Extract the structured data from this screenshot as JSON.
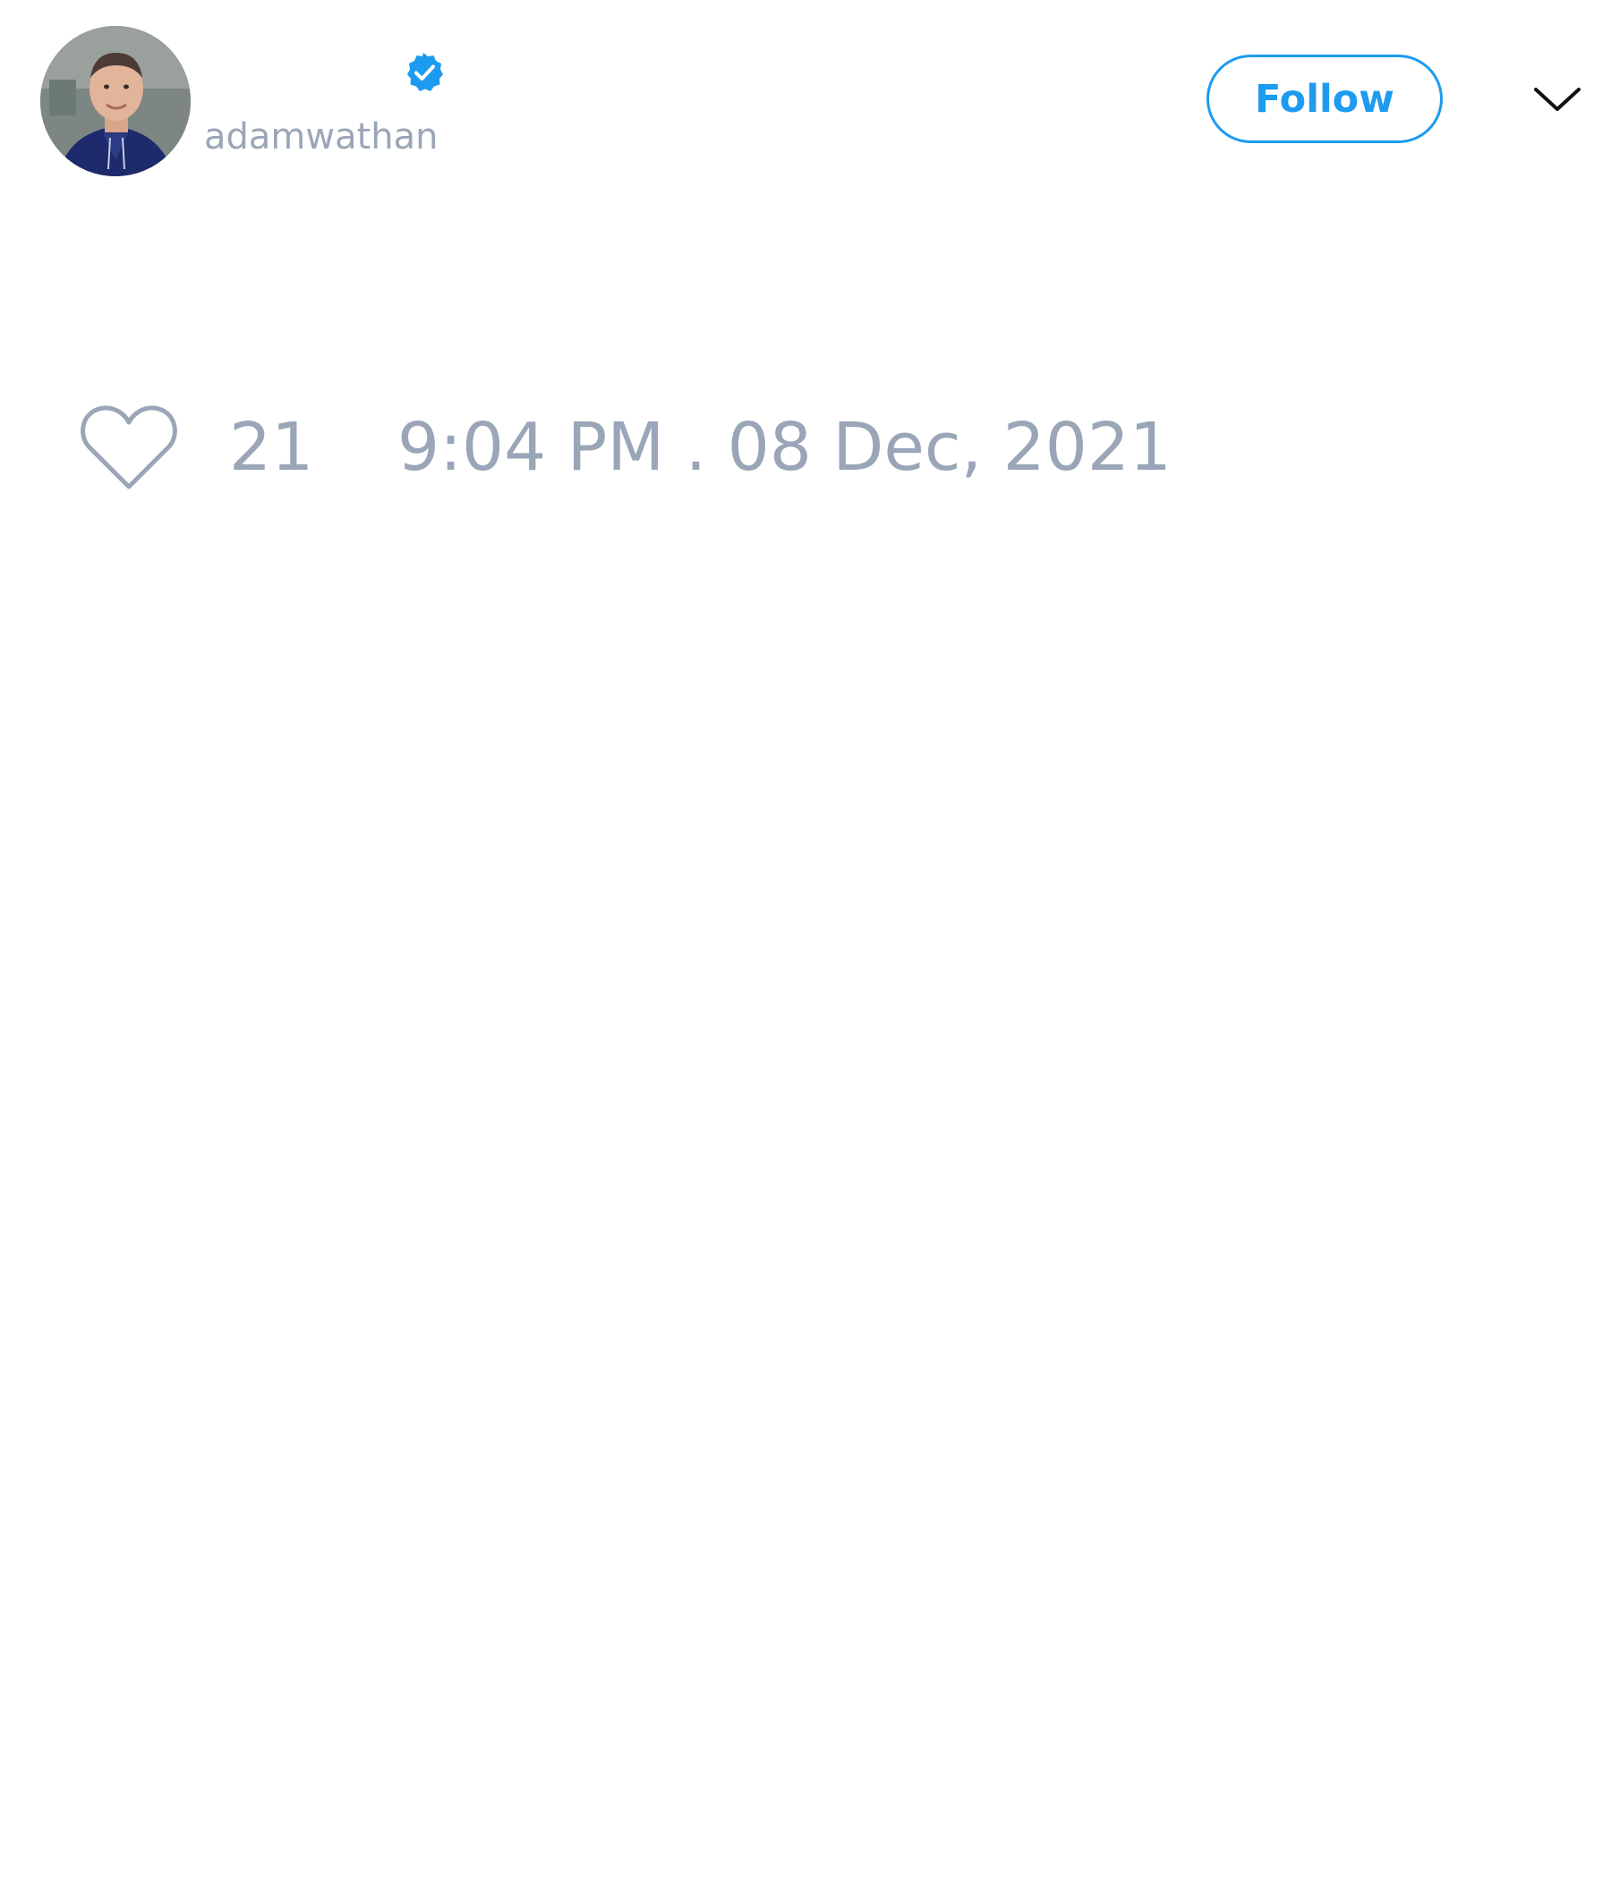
{
  "tweet": {
    "author": {
      "display_name": "",
      "username": "adamwathan",
      "verified_icon": "verified-badge-icon",
      "avatar": "avatar-photo"
    },
    "follow_label": "Follow",
    "more_icon": "chevron-down-icon",
    "like": {
      "icon": "heart-icon",
      "count": "21"
    },
    "timestamp": "9:04 PM . 08 Dec, 2021"
  },
  "colors": {
    "accent": "#1d9bf0",
    "muted_text": "#9aa6b7",
    "background": "#ffffff"
  }
}
